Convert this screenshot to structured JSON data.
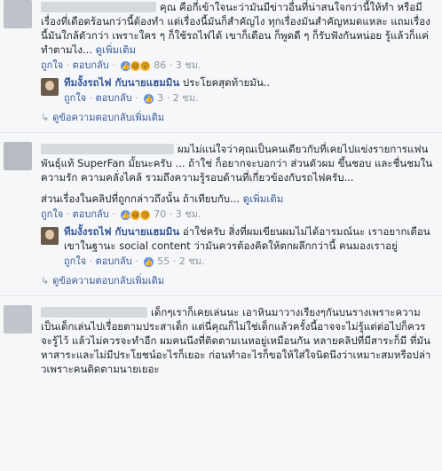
{
  "comments": [
    {
      "text": "คุณ คือกี่เข้าใจนะว่ามันมีข่าวอื่นที่น่าสนใจกว่านี้ให้ทำ หรือมีเรื่องที่เดือดร้อนกว่านี้ต้องทำ แต่เรื่องนี้มันก็สำคัญไง ทุกเรื่องมันสำคัญหมดแหละ แถมเรื่องนี้มันใกล้ตัวกว่า เพราะใคร ๆ ก็ใช้รถไฟได้ เขาก็เตือน ก็พูดดี ๆ ก็รับฟังกันหน่อย รู้แล้วก็แค่ทำตามไง...",
      "see_more": "ดูเพิ่มเติม",
      "like": "ถูกใจ",
      "reply": "ตอบกลับ",
      "reaction_count": "86",
      "time": "3 ชม.",
      "replies": [
        {
          "name": "ทีมงั้งรถไฟ กับนายแฮมมิน",
          "text": "ประโยคสุดท้ายมัน..",
          "like": "ถูกใจ",
          "reply": "ตอบกลับ",
          "reaction_count": "3",
          "time": "2 ชม."
        }
      ],
      "more_replies": "ดูข้อความตอบกลับเพิ่มเติม"
    },
    {
      "text": "ผมไม่แน่ใจว่าคุณเป็นคนเดียวกับที่เคยไปแข่งรายการแฟนพันธุ์แท้ SuperFan มั้ยนะครับ ... ถ้าใช่ ก็อยากจะบอกว่า ส่วนตัวผม ขึ้นชอบ และชื่นชมในความรัก ความคลั่งไคล้ รวมถึงความรู้รอบด้านที่เกี่ยวข้องกับรถไฟครับ...",
      "text2": "ส่วนเรื่องในคลิปที่ถูกกล่าวถึงนั้น ถ้าเทียบกับ...",
      "see_more": "ดูเพิ่มเติม",
      "like": "ถูกใจ",
      "reply": "ตอบกลับ",
      "reaction_count": "70",
      "time": "3 ชม.",
      "replies": [
        {
          "name": "ทีมงั้งรถไฟ กับนายแฮมมิน",
          "text": "อ่าใช่ครับ สิ่งที่ผมเขียนผมไม่ได้อารมณ์นะ เราอยากเตือนเขาในฐานะ social content ว่ามันควรต้องคิดให้ตกผลึกกว่านี้ คนมองเราอยู่",
          "like": "ถูกใจ",
          "reply": "ตอบกลับ",
          "reaction_count": "55",
          "time": "2 ชม."
        }
      ],
      "more_replies": "ดูข้อความตอบกลับเพิ่มเติม"
    },
    {
      "text": "เด็กๆเราก็เคยเล่นนะ เอาหินมาวางเรียงๆกันบนรางเพราะความเป็นเด็กเล่นไปเรื่อยตามประสาเด็ก แต่นี่คุณก็ไม่ใช่เด็กแล้วครั้งนี้อาจจะไม่รู้แต่ต่อไปก็ควรจะรู้ไว้ แล้วไม่ควรจะทำอีก ผมคนนึงที่ติดตามเนหอยู่เหมือนกัน หลายคลิปที่มีสาระก็มี ที่มันหาสาระและไม่มีประโยชน์อะไรก็เยอะ ก่อนทำอะไรก็ขอให้ใส่ใจนิดนึงว่าเหมาะสมหรือปล่าวเพราะคนติดตามนายเยอะ"
    }
  ]
}
